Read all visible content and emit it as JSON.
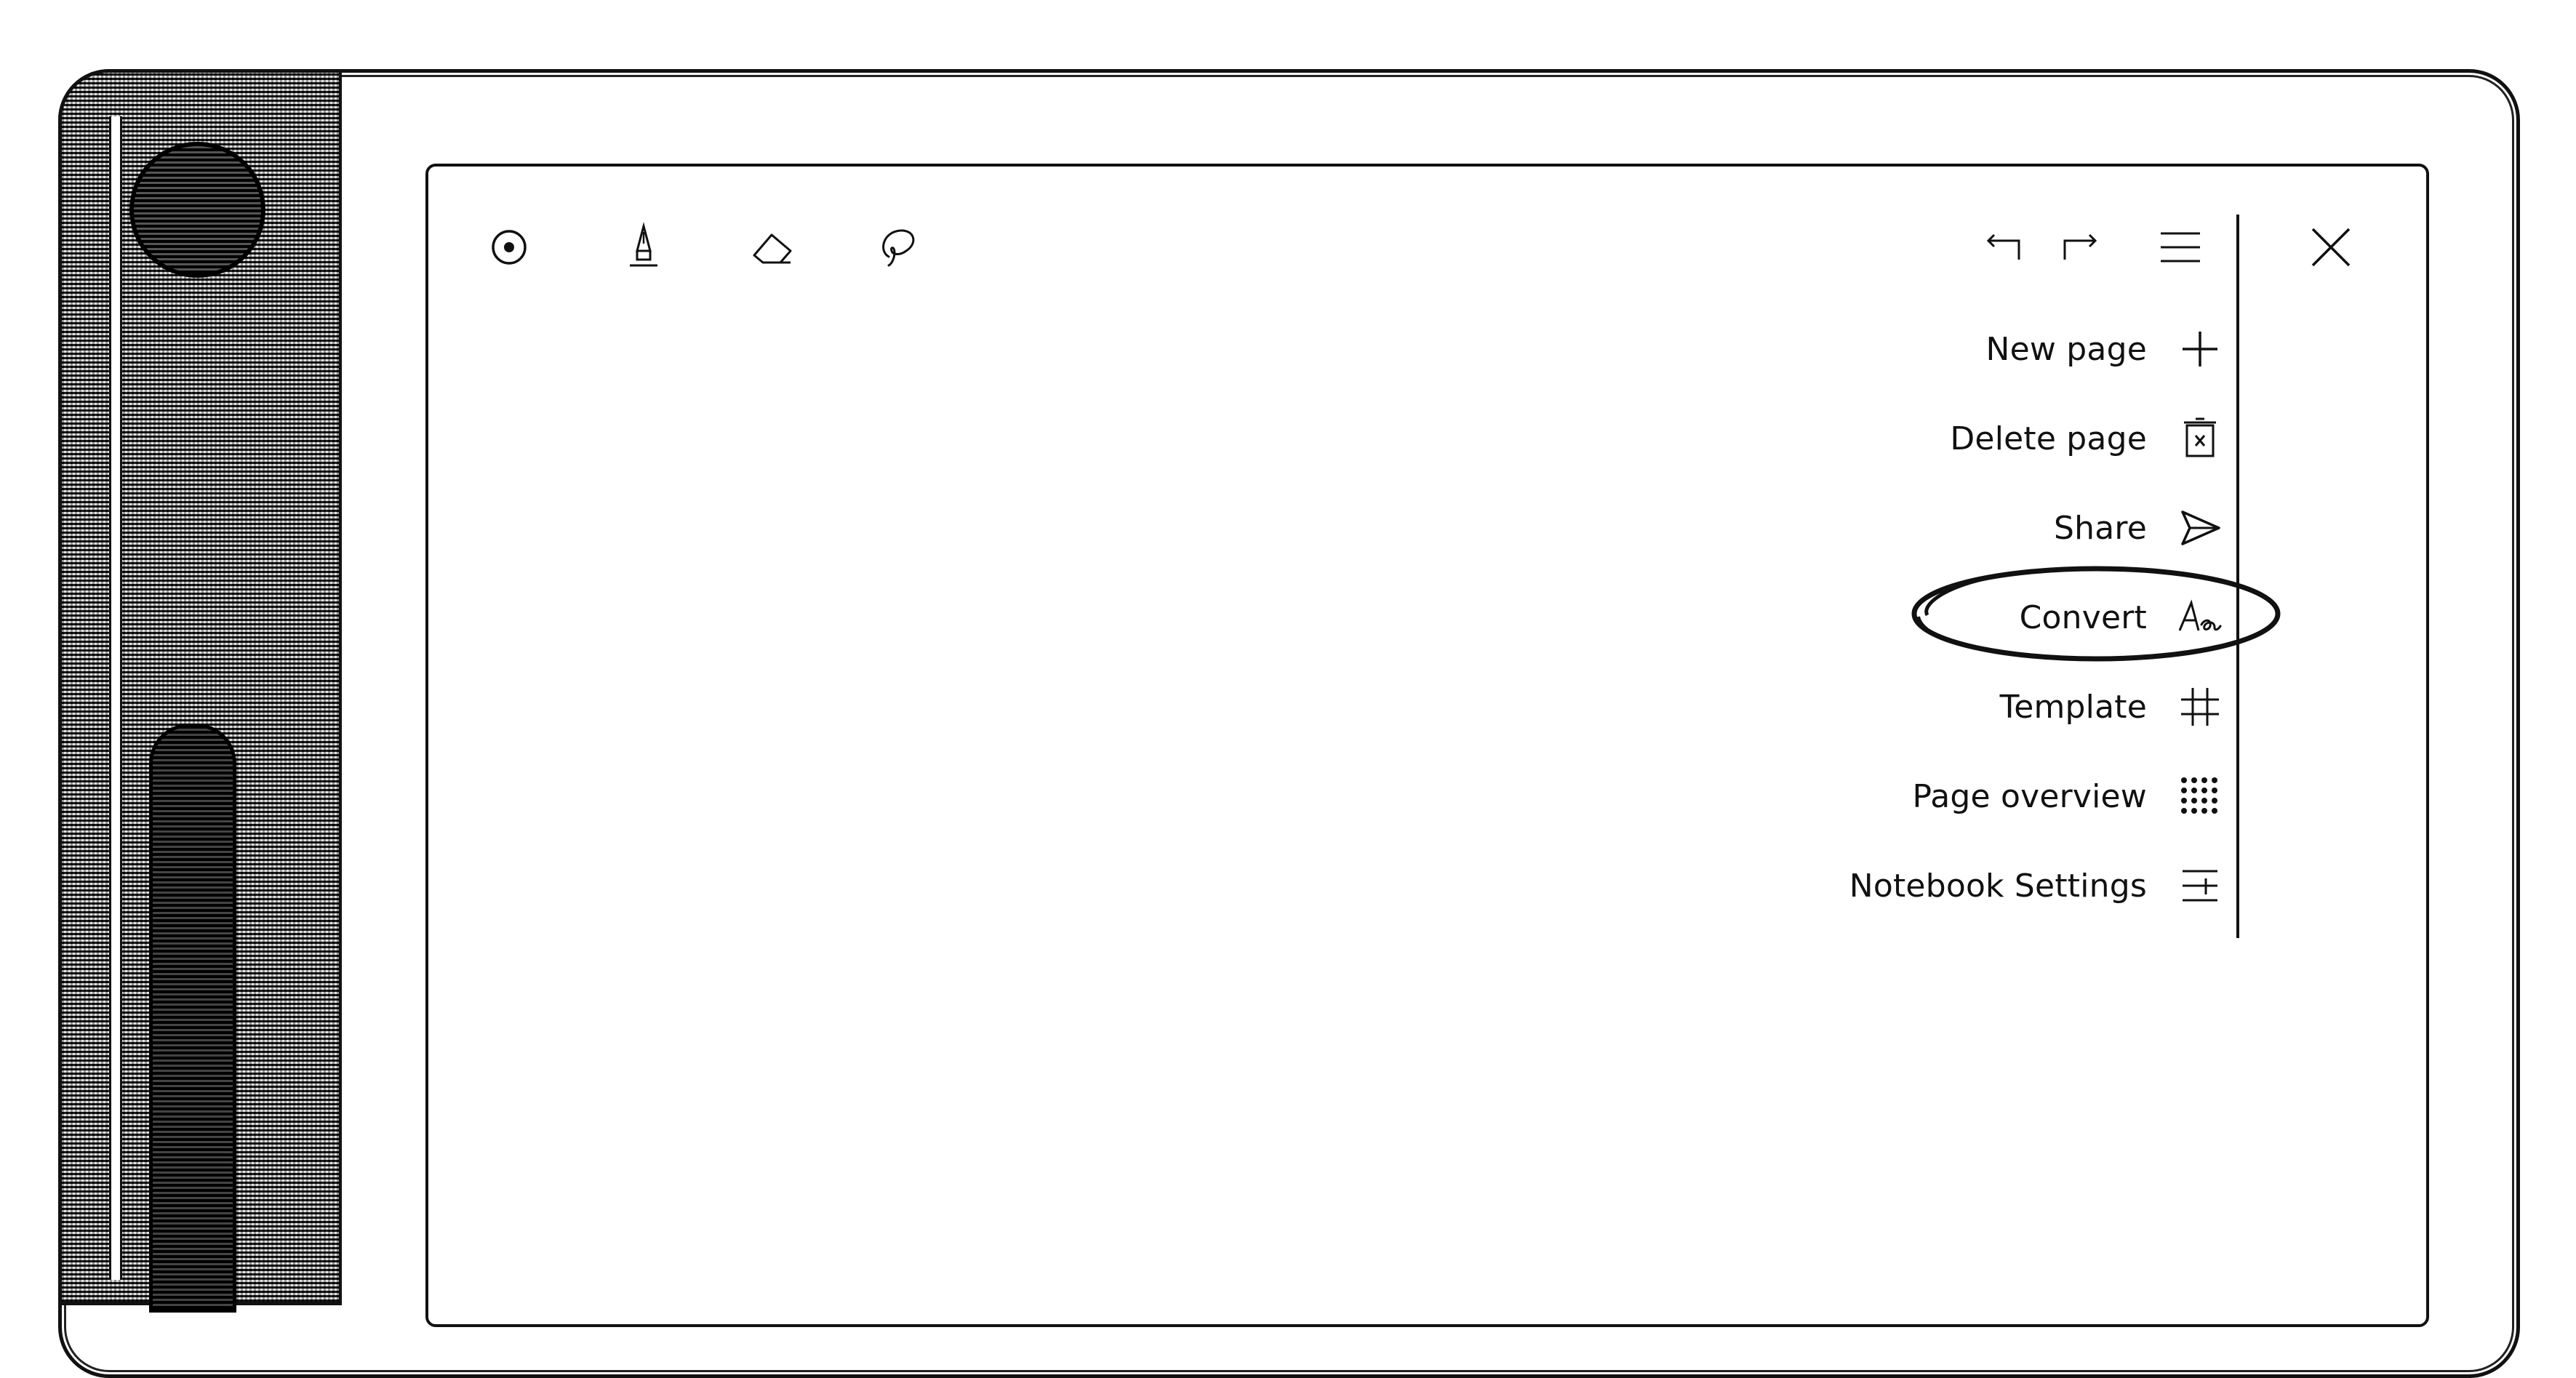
{
  "toolbar": {
    "left_tools": [
      {
        "name": "selection-tool",
        "icon": "radio-dot-icon"
      },
      {
        "name": "pen-tool",
        "icon": "fountain-pen-icon"
      },
      {
        "name": "eraser-tool",
        "icon": "eraser-icon"
      },
      {
        "name": "lasso-tool",
        "icon": "lasso-icon"
      }
    ],
    "right_tools": [
      {
        "name": "undo",
        "icon": "undo-icon"
      },
      {
        "name": "redo",
        "icon": "redo-icon"
      },
      {
        "name": "menu",
        "icon": "hamburger-icon"
      },
      {
        "name": "close",
        "icon": "close-icon"
      }
    ]
  },
  "menu": {
    "items": [
      {
        "label": "New page",
        "icon": "plus-icon"
      },
      {
        "label": "Delete page",
        "icon": "trash-icon"
      },
      {
        "label": "Share",
        "icon": "send-icon"
      },
      {
        "label": "Convert",
        "icon": "handwriting-convert-icon",
        "highlighted": true
      },
      {
        "label": "Template",
        "icon": "grid-icon"
      },
      {
        "label": "Page overview",
        "icon": "dots-grid-icon"
      },
      {
        "label": "Notebook Settings",
        "icon": "settings-lines-icon"
      }
    ]
  },
  "colors": {
    "ink": "#111111",
    "paper": "#ffffff"
  }
}
